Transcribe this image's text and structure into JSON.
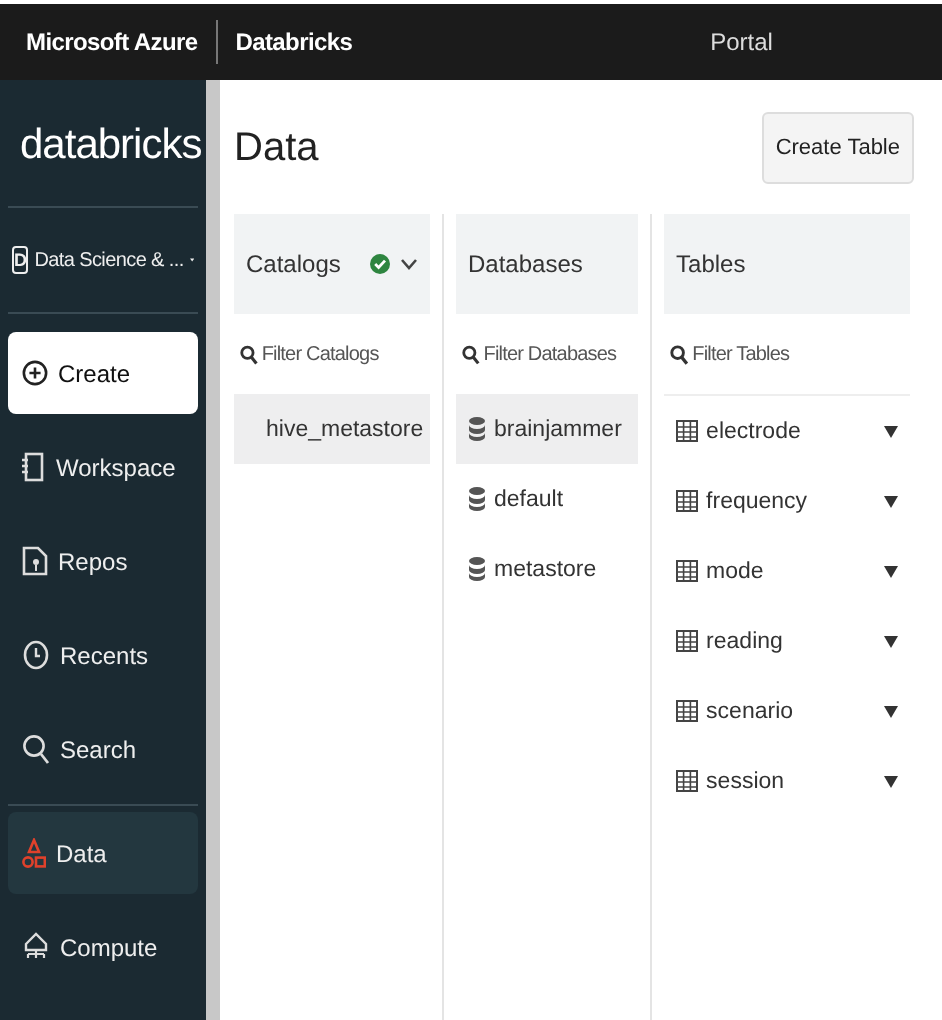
{
  "top_bar": {
    "brand": "Microsoft Azure",
    "product": "Databricks",
    "portal": "Portal"
  },
  "sidebar": {
    "logo": "databricks",
    "workspace": {
      "letter": "D",
      "label": "Data Science & ..."
    },
    "items": [
      {
        "kind": "create",
        "label": "Create",
        "selected": false
      },
      {
        "kind": "nav",
        "label": "Workspace",
        "selected": false
      },
      {
        "kind": "nav",
        "label": "Repos",
        "selected": false
      },
      {
        "kind": "nav",
        "label": "Recents",
        "selected": false
      },
      {
        "kind": "nav",
        "label": "Search",
        "selected": false
      },
      {
        "kind": "nav",
        "label": "Data",
        "selected": true
      },
      {
        "kind": "nav",
        "label": "Compute",
        "selected": false
      }
    ]
  },
  "page": {
    "title": "Data",
    "create_button": "Create Table"
  },
  "columns": [
    {
      "title": "Catalogs",
      "status_ok": true,
      "filter": {
        "placeholder": "Filter Catalogs"
      },
      "items": [
        {
          "kind": "catalog",
          "label": "hive_metastore",
          "selected": true
        }
      ]
    },
    {
      "title": "Databases",
      "status_ok": false,
      "filter": {
        "placeholder": "Filter Databases"
      },
      "items": [
        {
          "kind": "database",
          "label": "brainjammer",
          "selected": true
        },
        {
          "kind": "database",
          "label": "default",
          "selected": false
        },
        {
          "kind": "database",
          "label": "metastore",
          "selected": false
        }
      ]
    },
    {
      "title": "Tables",
      "status_ok": false,
      "filter": {
        "placeholder": "Filter Tables"
      },
      "items": [
        {
          "kind": "table",
          "label": "electrode",
          "selected": false
        },
        {
          "kind": "table",
          "label": "frequency",
          "selected": false
        },
        {
          "kind": "table",
          "label": "mode",
          "selected": false
        },
        {
          "kind": "table",
          "label": "reading",
          "selected": false
        },
        {
          "kind": "table",
          "label": "scenario",
          "selected": false
        },
        {
          "kind": "table",
          "label": "session",
          "selected": false
        }
      ]
    }
  ]
}
